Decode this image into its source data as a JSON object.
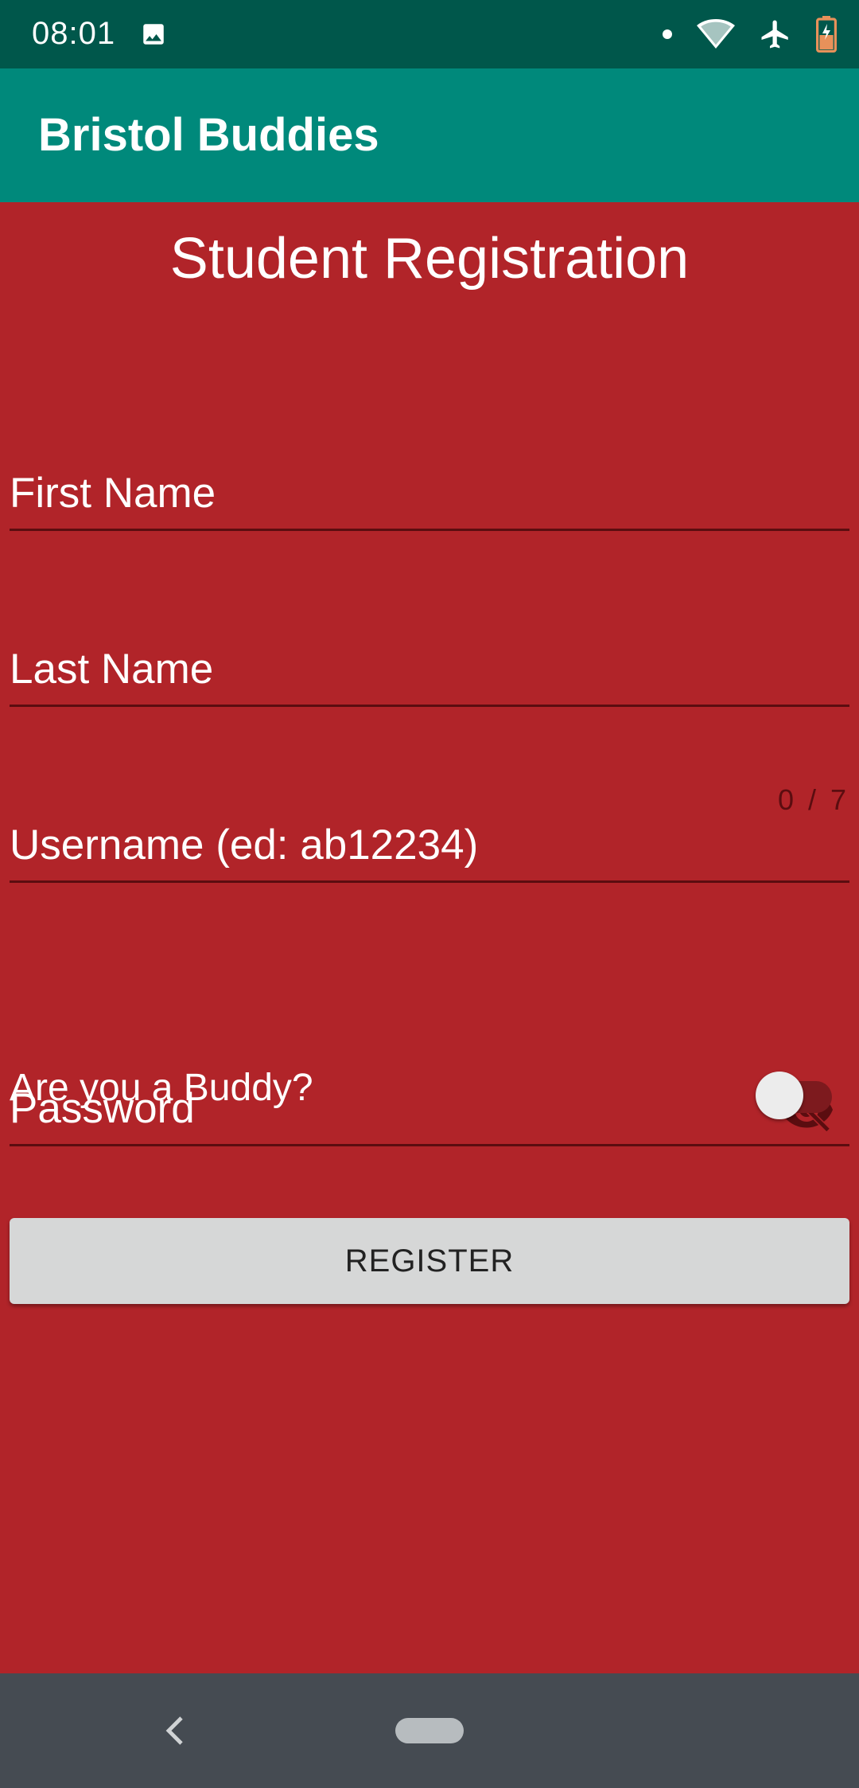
{
  "status_bar": {
    "time": "08:01",
    "icons": [
      "image-icon",
      "notification-dot-icon",
      "wifi-icon",
      "airplane-mode-icon",
      "battery-icon"
    ]
  },
  "app_bar": {
    "title": "Bristol Buddies"
  },
  "form": {
    "title": "Student Registration",
    "first_name": {
      "placeholder": "First Name",
      "value": ""
    },
    "last_name": {
      "placeholder": "Last Name",
      "value": ""
    },
    "username": {
      "placeholder": "Username (ed: ab12234)",
      "value": "",
      "counter": "0 / 7"
    },
    "password": {
      "placeholder": "Password",
      "value": ""
    },
    "buddy_toggle": {
      "label": "Are you a Buddy?",
      "checked": false
    },
    "register_label": "REGISTER"
  },
  "colors": {
    "status_bar": "#00574b",
    "app_bar": "#00897b",
    "background": "#b12429",
    "button": "#d6d7d7",
    "nav_bar": "#454b52"
  }
}
